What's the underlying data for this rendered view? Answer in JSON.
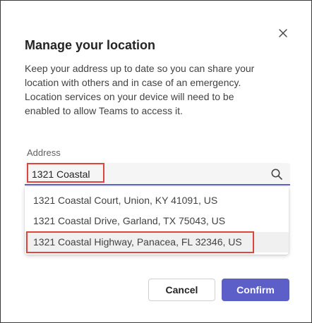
{
  "dialog": {
    "title": "Manage your location",
    "description": "Keep your address up to date so you can share your location with others and in case of an emergency. Location services on your device will need to be enabled to allow Teams to access it."
  },
  "address": {
    "label": "Address",
    "value": "1321 Coastal",
    "suggestions": [
      "1321 Coastal Court, Union, KY 41091, US",
      "1321 Coastal Drive, Garland, TX 75043, US",
      "1321 Coastal Highway, Panacea, FL 32346, US"
    ]
  },
  "buttons": {
    "cancel": "Cancel",
    "confirm": "Confirm"
  },
  "colors": {
    "accent": "#5b5fc7",
    "highlight_box": "#e0453b"
  },
  "icons": {
    "close": "close-icon",
    "search": "search-icon"
  }
}
